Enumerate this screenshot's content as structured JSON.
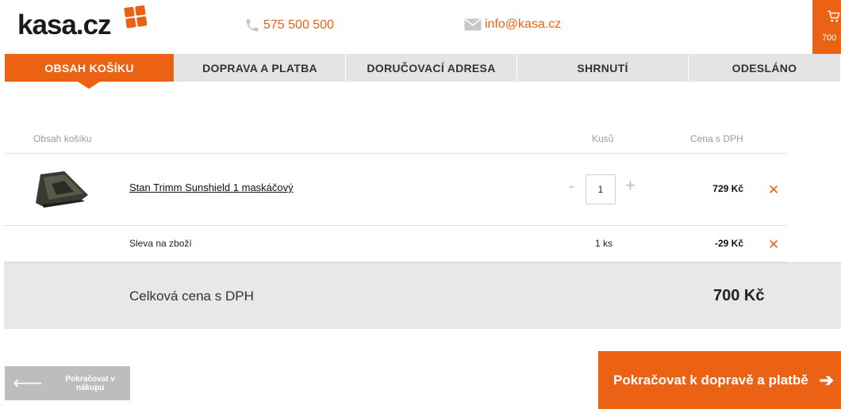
{
  "header": {
    "logo_text": "kasa.cz",
    "phone": "575 500 500",
    "email": "info@kasa.cz",
    "cart_total": "700"
  },
  "steps": [
    {
      "label": "OBSAH KOŠÍKU",
      "active": true
    },
    {
      "label": "DOPRAVA A PLATBA",
      "active": false
    },
    {
      "label": "DORUČOVACÍ ADRESA",
      "active": false
    },
    {
      "label": "SHRNUTÍ",
      "active": false
    },
    {
      "label": "ODESLÁNO",
      "active": false
    }
  ],
  "table": {
    "headers": {
      "content": "Obsah košíku",
      "qty": "Kusů",
      "price": "Cena s DPH"
    },
    "product": {
      "name": "Stan Trimm Sunshield 1 maskáčový",
      "qty": "1",
      "minus": "-",
      "plus": "+",
      "price": "729 Kč",
      "remove": "✕"
    },
    "discount": {
      "label": "Sleva na zboží",
      "qty": "1 ks",
      "price": "-29 Kč",
      "remove": "✕"
    },
    "total": {
      "label": "Celková cena s DPH",
      "value": "700 Kč"
    }
  },
  "buttons": {
    "back": "Pokračovat v nákupu",
    "back_arrow": "🡐",
    "continue": "Pokračovat k dopravě a platbě",
    "continue_arrow": "➔"
  },
  "colors": {
    "accent": "#ec6215",
    "step_bg": "#e4e4e4",
    "total_bg": "#e8e8e8",
    "back_button": "#bdbdbd"
  }
}
